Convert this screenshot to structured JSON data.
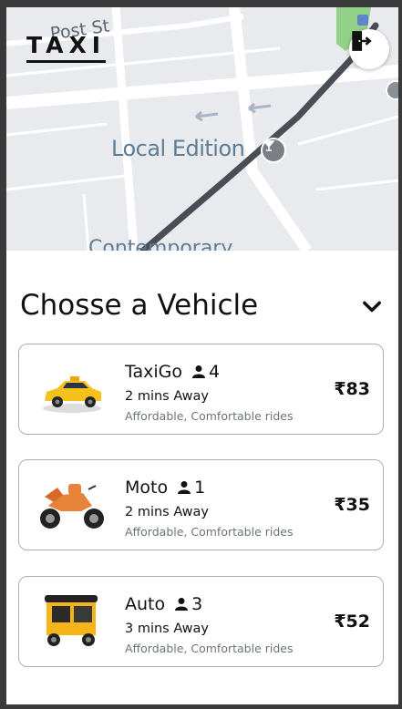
{
  "app": {
    "brand": "TAXI"
  },
  "map": {
    "street_label": "Post St",
    "poi_label": "Local Edition",
    "bottom_label": "Contemporary"
  },
  "section": {
    "title": "Chosse a Vehicle"
  },
  "vehicles": [
    {
      "name": "TaxiGo",
      "capacity": "4",
      "eta": "2 mins Away",
      "desc": "Affordable, Comfortable rides",
      "price": "₹83",
      "icon": "taxi-car-icon"
    },
    {
      "name": "Moto",
      "capacity": "1",
      "eta": "2 mins Away",
      "desc": "Affordable, Comfortable rides",
      "price": "₹35",
      "icon": "motorbike-icon"
    },
    {
      "name": "Auto",
      "capacity": "3",
      "eta": "3 mins Away",
      "desc": "Affordable, Comfortable rides",
      "price": "₹52",
      "icon": "auto-rickshaw-icon"
    }
  ]
}
